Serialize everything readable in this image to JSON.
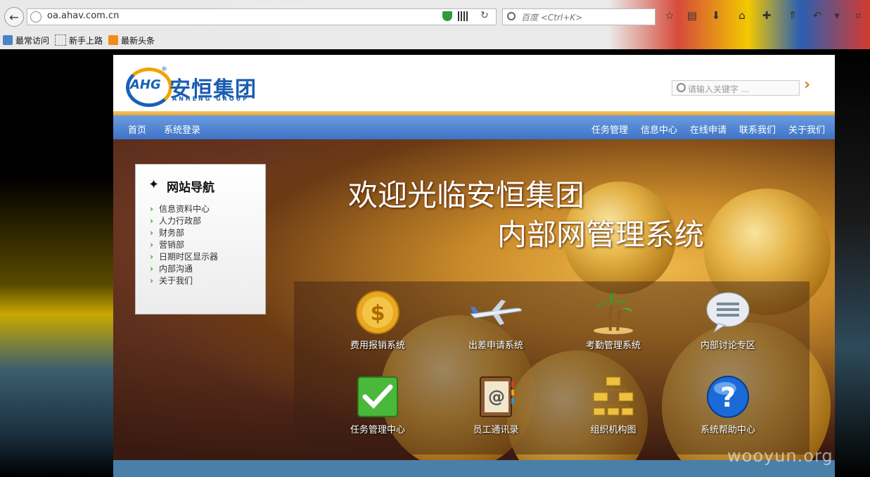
{
  "browser": {
    "url": "oa.ahav.com.cn",
    "search_placeholder": "百度 <Ctrl+K>",
    "bookmarks": [
      "最常访问",
      "新手上路",
      "最新头条"
    ]
  },
  "site": {
    "logo_abbr": "AHG",
    "logo_cn": "安恒集团",
    "logo_en": "ANHENG GROUP",
    "search_placeholder": "请输入关键字 ...",
    "nav_left": [
      "首页",
      "系统登录"
    ],
    "nav_right": [
      "任务管理",
      "信息中心",
      "在线申请",
      "联系我们",
      "关于我们"
    ]
  },
  "sidebar": {
    "title": "网站导航",
    "items": [
      "信息资料中心",
      "人力行政部",
      "财务部",
      "营销部",
      "日期时区显示器",
      "内部沟通",
      "关于我们"
    ]
  },
  "banner": {
    "line1": "欢迎光临安恒集团",
    "line2": "内部网管理系统"
  },
  "apps": [
    {
      "label": "费用报销系统",
      "icon": "coin-dollar-icon"
    },
    {
      "label": "出差申请系统",
      "icon": "airplane-icon"
    },
    {
      "label": "考勤管理系统",
      "icon": "palm-island-icon"
    },
    {
      "label": "内部讨论专区",
      "icon": "chat-bubble-icon"
    },
    {
      "label": "任务管理中心",
      "icon": "checkmark-icon"
    },
    {
      "label": "员工通讯录",
      "icon": "address-book-icon"
    },
    {
      "label": "组织机构图",
      "icon": "org-chart-icon"
    },
    {
      "label": "系统帮助中心",
      "icon": "help-icon"
    }
  ],
  "watermark": "wooyun.org"
}
